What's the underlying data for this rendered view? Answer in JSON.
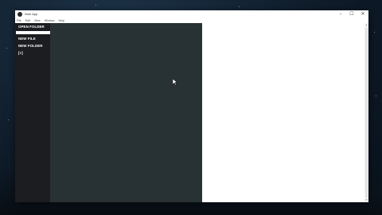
{
  "window": {
    "title": "Nioh App",
    "controls": {
      "minimize": "–",
      "maximize": "☐",
      "close": "✕"
    }
  },
  "menu": [
    "File",
    "Edit",
    "View",
    "Window",
    "Help"
  ],
  "sidebar": {
    "open_folder": "OPEN FOLDER",
    "new_file": "NEW FILE",
    "new_folder": "NEW FOLDER",
    "code_icon_label": "[≡]"
  },
  "colors": {
    "sidebar_bg": "#1c1d21",
    "editor_bg": "#283133",
    "preview_bg": "#ffffff"
  }
}
